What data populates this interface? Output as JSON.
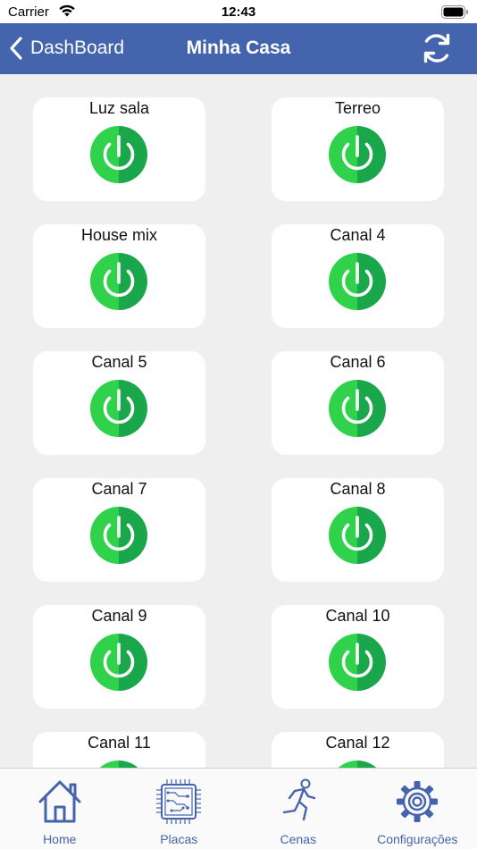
{
  "status": {
    "carrier": "Carrier",
    "time": "12:43"
  },
  "nav": {
    "back_label": "DashBoard",
    "title": "Minha Casa",
    "refresh_icon": "refresh-icon"
  },
  "colors": {
    "nav_bg": "#4464ad",
    "power_green_light": "#2fd24a",
    "power_green_dark": "#1aa64a",
    "tab_tint": "#4464ad"
  },
  "channels": [
    {
      "label": "Luz sala"
    },
    {
      "label": "Terreo"
    },
    {
      "label": "House mix"
    },
    {
      "label": "Canal 4"
    },
    {
      "label": "Canal 5"
    },
    {
      "label": "Canal 6"
    },
    {
      "label": "Canal 7"
    },
    {
      "label": "Canal 8"
    },
    {
      "label": "Canal 9"
    },
    {
      "label": "Canal 10"
    },
    {
      "label": "Canal 11"
    },
    {
      "label": "Canal 12"
    }
  ],
  "tabs": [
    {
      "label": "Home",
      "icon": "home-icon"
    },
    {
      "label": "Placas",
      "icon": "circuit-board-icon"
    },
    {
      "label": "Cenas",
      "icon": "running-person-icon"
    },
    {
      "label": "Configurações",
      "icon": "gear-icon"
    }
  ]
}
